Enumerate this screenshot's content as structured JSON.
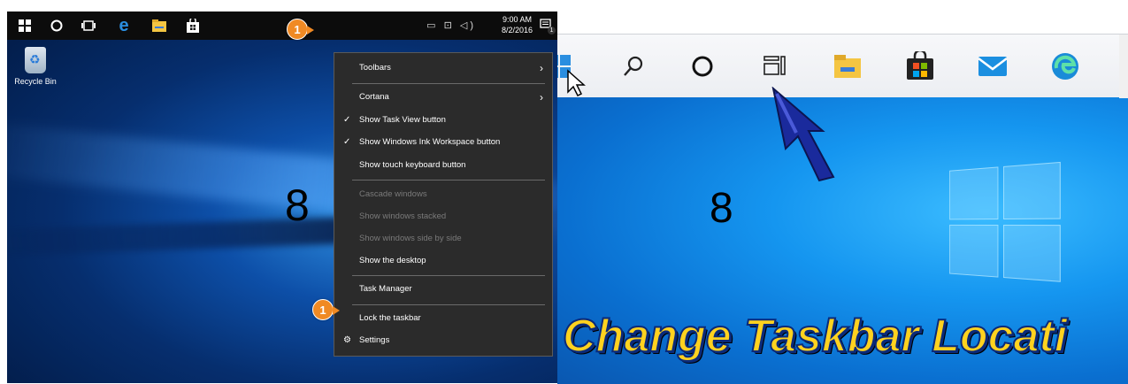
{
  "left_screenshot": {
    "taskbar": {
      "icons": [
        "windows-icon",
        "cortana-circle-icon",
        "task-view-icon",
        "edge-icon",
        "file-explorer-icon",
        "store-icon"
      ],
      "tray_icons": [
        "battery-icon",
        "network-icon",
        "volume-icon"
      ],
      "time": "9:00 AM",
      "date": "8/2/2016",
      "notification_count": "1"
    },
    "badge_top": "1",
    "badge_menu": "1",
    "desktop_icon_label": "Recycle Bin",
    "overlay_number": "8",
    "context_menu": {
      "items": [
        {
          "label": "Toolbars",
          "submenu": true
        },
        {
          "label": "Cortana",
          "submenu": true
        },
        {
          "label": "Show Task View button",
          "checked": true
        },
        {
          "label": "Show Windows Ink Workspace button",
          "checked": true
        },
        {
          "label": "Show touch keyboard button"
        },
        {
          "label": "Cascade windows",
          "disabled": true
        },
        {
          "label": "Show windows stacked",
          "disabled": true
        },
        {
          "label": "Show windows side by side",
          "disabled": true
        },
        {
          "label": "Show the desktop"
        },
        {
          "label": "Task Manager"
        },
        {
          "label": "Lock the taskbar"
        },
        {
          "label": "Settings",
          "icon": "gear-icon"
        }
      ]
    }
  },
  "right_screenshot": {
    "taskbar_icons": [
      "windows-icon",
      "search-icon",
      "cortana-circle-icon",
      "task-view-icon",
      "file-explorer-icon",
      "store-icon",
      "mail-icon",
      "edge-icon"
    ],
    "overlay_number": "8",
    "banner_text": "Change Taskbar Locati"
  },
  "colors": {
    "badge": "#f08a24",
    "menu_bg": "#2b2b2b",
    "banner_text": "#ffd21f"
  }
}
